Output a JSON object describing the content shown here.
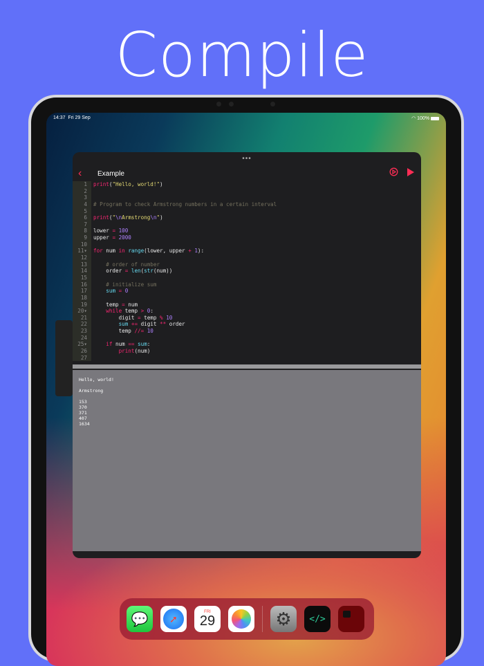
{
  "headline": "Compile",
  "status": {
    "time": "14:37",
    "date": "Fri 29 Sep",
    "battery": "100%"
  },
  "window": {
    "title": "Example",
    "menu": "•••"
  },
  "code": [
    [
      [
        "print",
        "kw"
      ],
      [
        "(",
        ""
      ],
      [
        "\"Hello, world!\"",
        "str"
      ],
      [
        ")",
        ""
      ]
    ],
    [],
    [],
    [
      [
        "# Program to check Armstrong numbers in a certain interval",
        "cm"
      ]
    ],
    [],
    [
      [
        "print",
        "kw"
      ],
      [
        "(",
        ""
      ],
      [
        "\"",
        "str"
      ],
      [
        "\\n",
        "esc"
      ],
      [
        "Armstrong",
        "str"
      ],
      [
        "\\n",
        "esc"
      ],
      [
        "\"",
        "str"
      ],
      [
        ")",
        ""
      ]
    ],
    [],
    [
      [
        "lower ",
        ""
      ],
      [
        "=",
        "op"
      ],
      [
        " ",
        ""
      ],
      [
        "100",
        "num"
      ]
    ],
    [
      [
        "upper ",
        ""
      ],
      [
        "=",
        "op"
      ],
      [
        " ",
        ""
      ],
      [
        "2000",
        "num"
      ]
    ],
    [],
    [
      [
        "for",
        "kw"
      ],
      [
        " num ",
        ""
      ],
      [
        "in",
        "kw"
      ],
      [
        " ",
        ""
      ],
      [
        "range",
        "bi"
      ],
      [
        "(lower, upper ",
        ""
      ],
      [
        "+",
        "op"
      ],
      [
        " ",
        ""
      ],
      [
        "1",
        "num"
      ],
      [
        "):",
        ""
      ]
    ],
    [],
    [
      [
        "    # order of number",
        "cm"
      ]
    ],
    [
      [
        "    order ",
        ""
      ],
      [
        "=",
        "op"
      ],
      [
        " ",
        ""
      ],
      [
        "len",
        "bi"
      ],
      [
        "(",
        ""
      ],
      [
        "str",
        "bi"
      ],
      [
        "(num))",
        ""
      ]
    ],
    [],
    [
      [
        "    # initialize sum",
        "cm"
      ]
    ],
    [
      [
        "    ",
        ""
      ],
      [
        "sum",
        "bi"
      ],
      [
        " ",
        ""
      ],
      [
        "=",
        "op"
      ],
      [
        " ",
        ""
      ],
      [
        "0",
        "num"
      ]
    ],
    [],
    [
      [
        "    temp ",
        ""
      ],
      [
        "=",
        "op"
      ],
      [
        " num",
        ""
      ]
    ],
    [
      [
        "    ",
        ""
      ],
      [
        "while",
        "kw"
      ],
      [
        " temp ",
        ""
      ],
      [
        ">",
        "op"
      ],
      [
        " ",
        ""
      ],
      [
        "0",
        "num"
      ],
      [
        ":",
        ""
      ]
    ],
    [
      [
        "        digit ",
        ""
      ],
      [
        "=",
        "op"
      ],
      [
        " temp ",
        ""
      ],
      [
        "%",
        "op"
      ],
      [
        " ",
        ""
      ],
      [
        "10",
        "num"
      ]
    ],
    [
      [
        "        ",
        ""
      ],
      [
        "sum",
        "bi"
      ],
      [
        " ",
        ""
      ],
      [
        "+=",
        "op"
      ],
      [
        " digit ",
        ""
      ],
      [
        "**",
        "op"
      ],
      [
        " order",
        ""
      ]
    ],
    [
      [
        "        temp ",
        ""
      ],
      [
        "//=",
        "op"
      ],
      [
        " ",
        ""
      ],
      [
        "10",
        "num"
      ]
    ],
    [],
    [
      [
        "    ",
        ""
      ],
      [
        "if",
        "kw"
      ],
      [
        " num ",
        ""
      ],
      [
        "==",
        "op"
      ],
      [
        " ",
        ""
      ],
      [
        "sum",
        "bi"
      ],
      [
        ":",
        ""
      ]
    ],
    [
      [
        "        ",
        ""
      ],
      [
        "print",
        "kw"
      ],
      [
        "(num)",
        ""
      ]
    ],
    []
  ],
  "folds": [
    11,
    20,
    25
  ],
  "console": "Hello, world!\n\nArmstrong\n\n153\n370\n371\n407\n1634",
  "dock": {
    "calendar_day": "FRI",
    "calendar_date": "29"
  },
  "colors": {
    "background": "#6170f9",
    "accent": "#ff2d55",
    "console": "#79787d"
  }
}
